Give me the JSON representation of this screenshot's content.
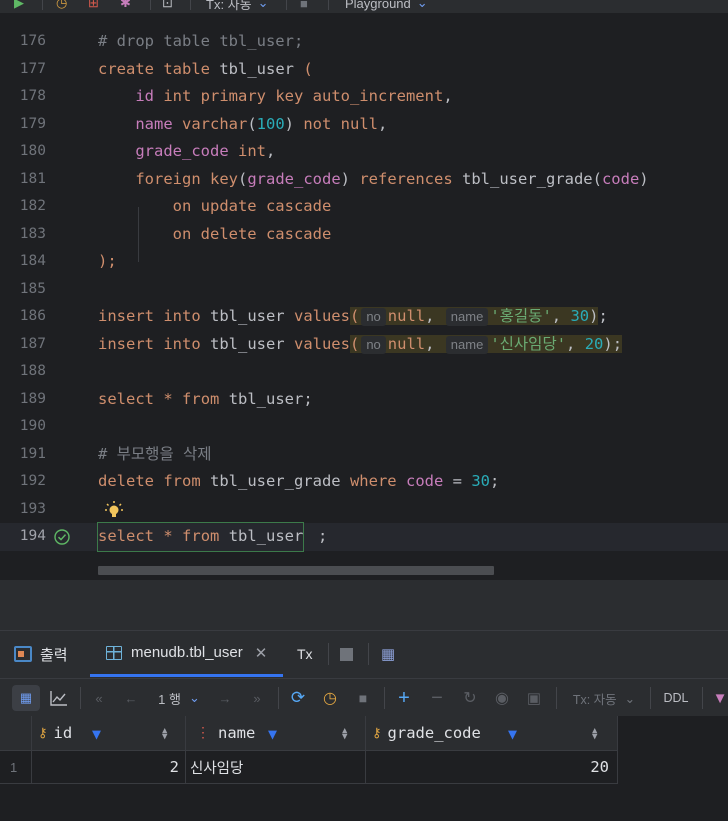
{
  "toolbar_top": {
    "tx_label": "Tx: 자동",
    "playground_label": "Playground"
  },
  "editor": {
    "lines": [
      {
        "n": "176"
      },
      {
        "n": "177"
      },
      {
        "n": "178"
      },
      {
        "n": "179"
      },
      {
        "n": "180"
      },
      {
        "n": "181"
      },
      {
        "n": "182"
      },
      {
        "n": "183"
      },
      {
        "n": "184"
      },
      {
        "n": "185"
      },
      {
        "n": "186"
      },
      {
        "n": "187"
      },
      {
        "n": "188"
      },
      {
        "n": "189"
      },
      {
        "n": "190"
      },
      {
        "n": "191"
      },
      {
        "n": "192"
      },
      {
        "n": "193"
      },
      {
        "n": "194"
      }
    ],
    "inlay_no": "no",
    "inlay_name": "name"
  },
  "tabs": {
    "output": "출력",
    "table": "menudb.tbl_user",
    "tx": "Tx"
  },
  "result_toolbar": {
    "page_label": "1 행",
    "tx_mode": "Tx: 자동",
    "ddl": "DDL"
  },
  "result": {
    "columns": [
      "id",
      "name",
      "grade_code"
    ],
    "rows": [
      {
        "rownum": "1",
        "id": "2",
        "name": "신사임당",
        "grade_code": "20"
      }
    ]
  },
  "colors": {
    "accent": "#3574f0",
    "keyword": "#cf8e6d",
    "number": "#2aacb8",
    "string": "#6aab73",
    "comment": "#7a7e85"
  }
}
